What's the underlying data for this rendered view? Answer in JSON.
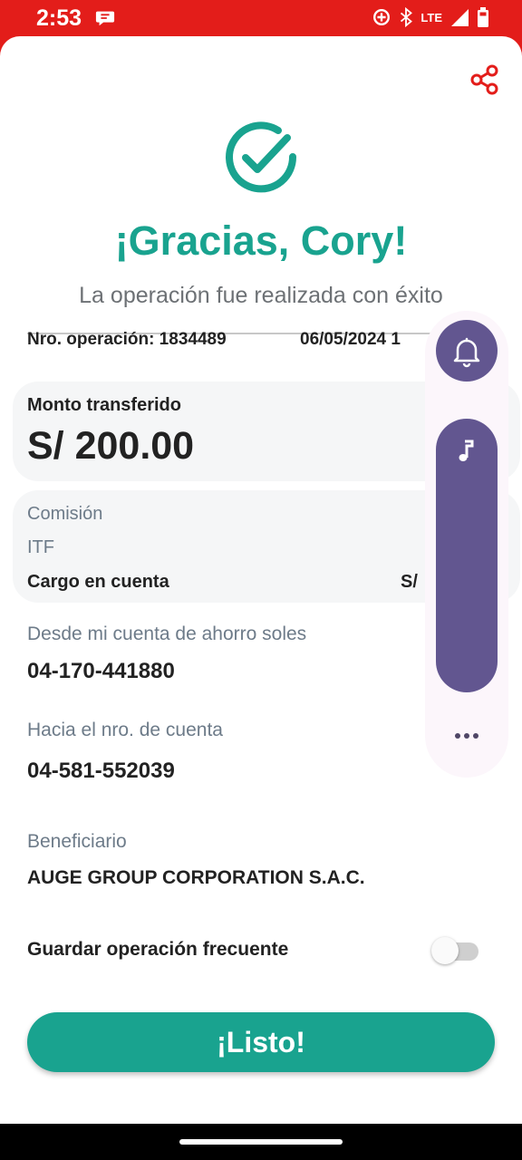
{
  "status_bar": {
    "time": "2:53",
    "network": "LTE",
    "icons": [
      "message-icon",
      "data-saver-icon",
      "bluetooth-icon",
      "signal-icon",
      "battery-icon"
    ]
  },
  "receipt": {
    "title": "¡Gracias, Cory!",
    "subtitle": "La operación fue realizada con éxito",
    "operation_number": "Nro. operación: 1834489",
    "operation_date": "06/05/2024 1",
    "transfer": {
      "label": "Monto transferido",
      "amount": "S/ 200.00"
    },
    "charges": {
      "commission_label": "Comisión",
      "itf_label": "ITF",
      "account_charge_label": "Cargo en cuenta",
      "account_charge_value": "S/"
    },
    "from": {
      "label": "Desde mi cuenta de ahorro soles",
      "value": "04-170-441880"
    },
    "to": {
      "label": "Hacia el nro. de cuenta",
      "value": "04-581-552039"
    },
    "beneficiary": {
      "label": "Beneficiario",
      "value": "AUGE GROUP CORPORATION S.A.C."
    },
    "save_frequent": {
      "label": "Guardar operación frecuente",
      "enabled": false
    },
    "done_button": "¡Listo!"
  },
  "volume_panel": {
    "icons": [
      "bell-icon",
      "music-note-icon",
      "more-icon"
    ],
    "media_volume_level": 1.0
  },
  "colors": {
    "brand_red": "#e31d1a",
    "accent_teal": "#19a38f",
    "volume_purple": "#625690"
  }
}
